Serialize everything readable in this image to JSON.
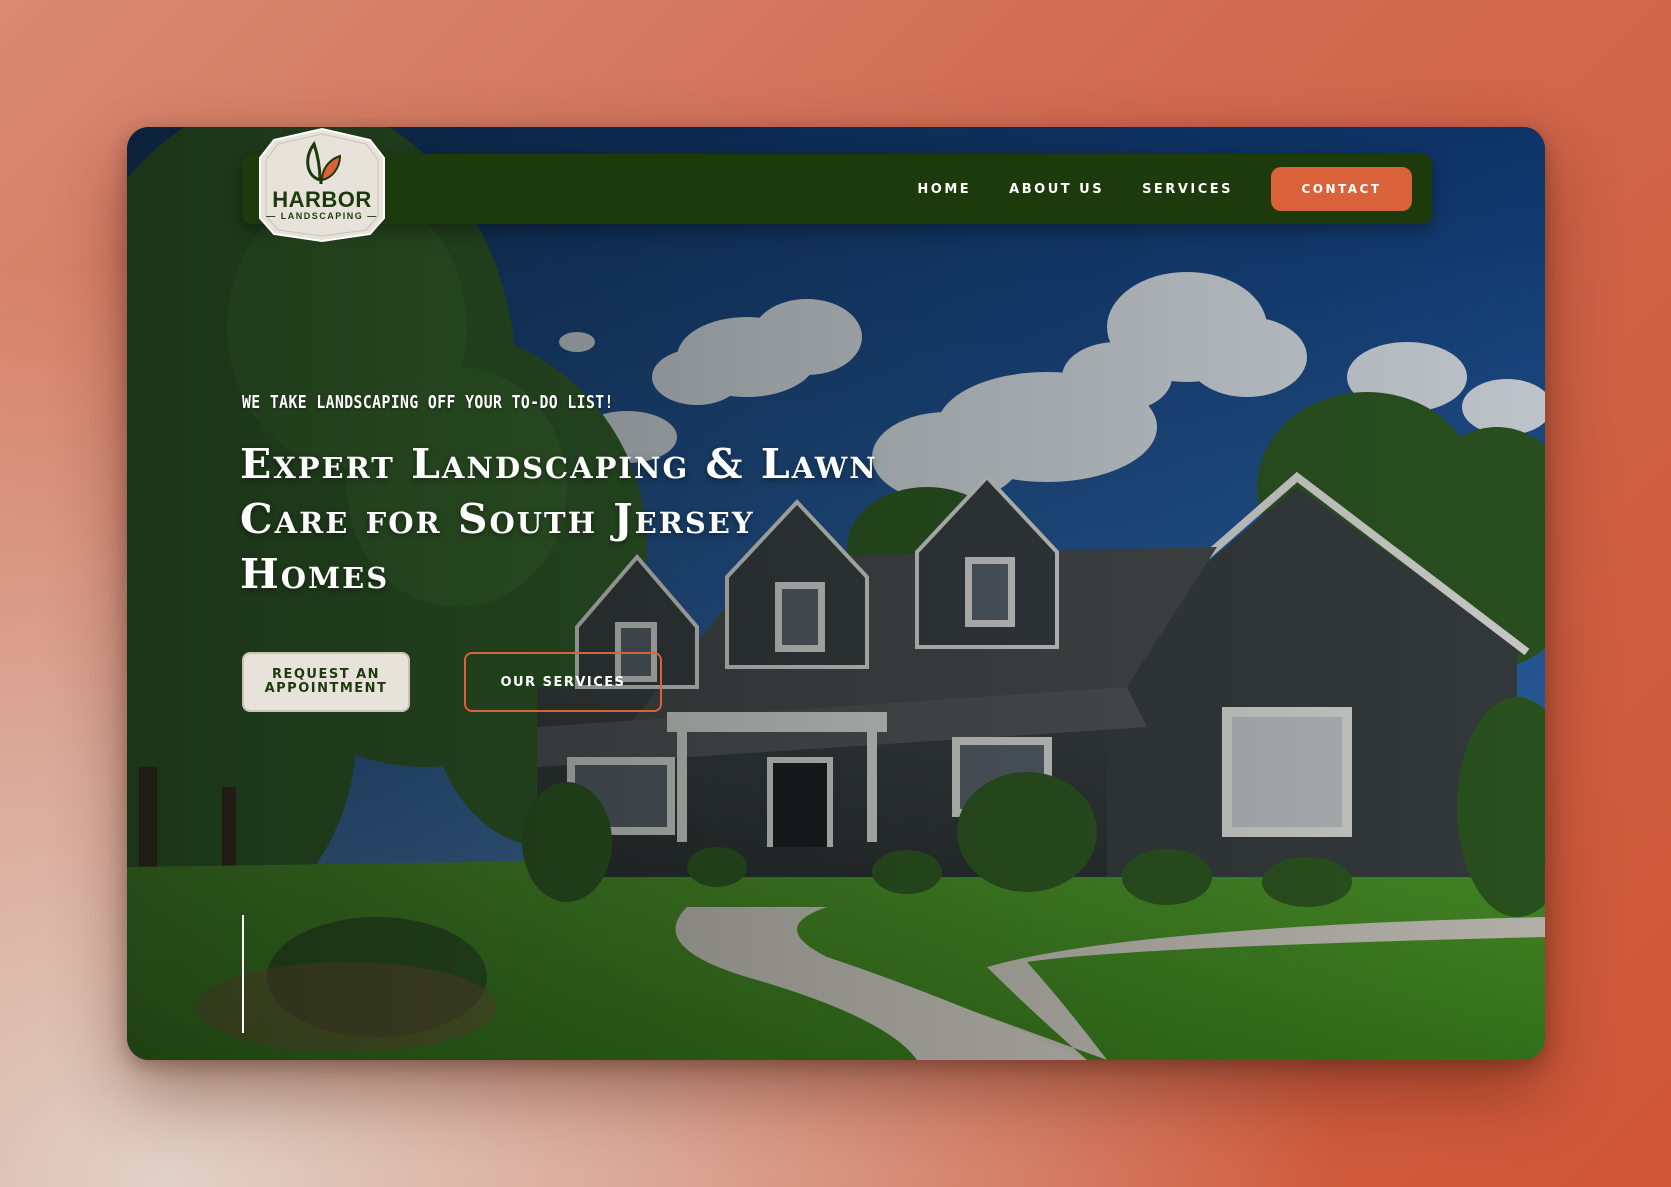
{
  "brand": {
    "name": "HARBOR",
    "subtitle": "— LANDSCAPING —",
    "color_primary": "#1d3a0c",
    "color_accent": "#d9623a",
    "color_cream": "#e7e3da",
    "logo_icon": "leaf-sprout-icon"
  },
  "nav": {
    "items": [
      {
        "label": "HOME"
      },
      {
        "label": "ABOUT US"
      },
      {
        "label": "SERVICES"
      }
    ],
    "cta_label": "CONTACT"
  },
  "hero": {
    "tagline": "WE TAKE LANDSCAPING OFF YOUR TO-DO LIST!",
    "headline": "Expert Landscaping & Lawn Care for South Jersey Homes",
    "primary_button": "REQUEST AN APPOINTMENT",
    "secondary_button": "OUR SERVICES",
    "background_image": "house-with-lawn-photo"
  }
}
